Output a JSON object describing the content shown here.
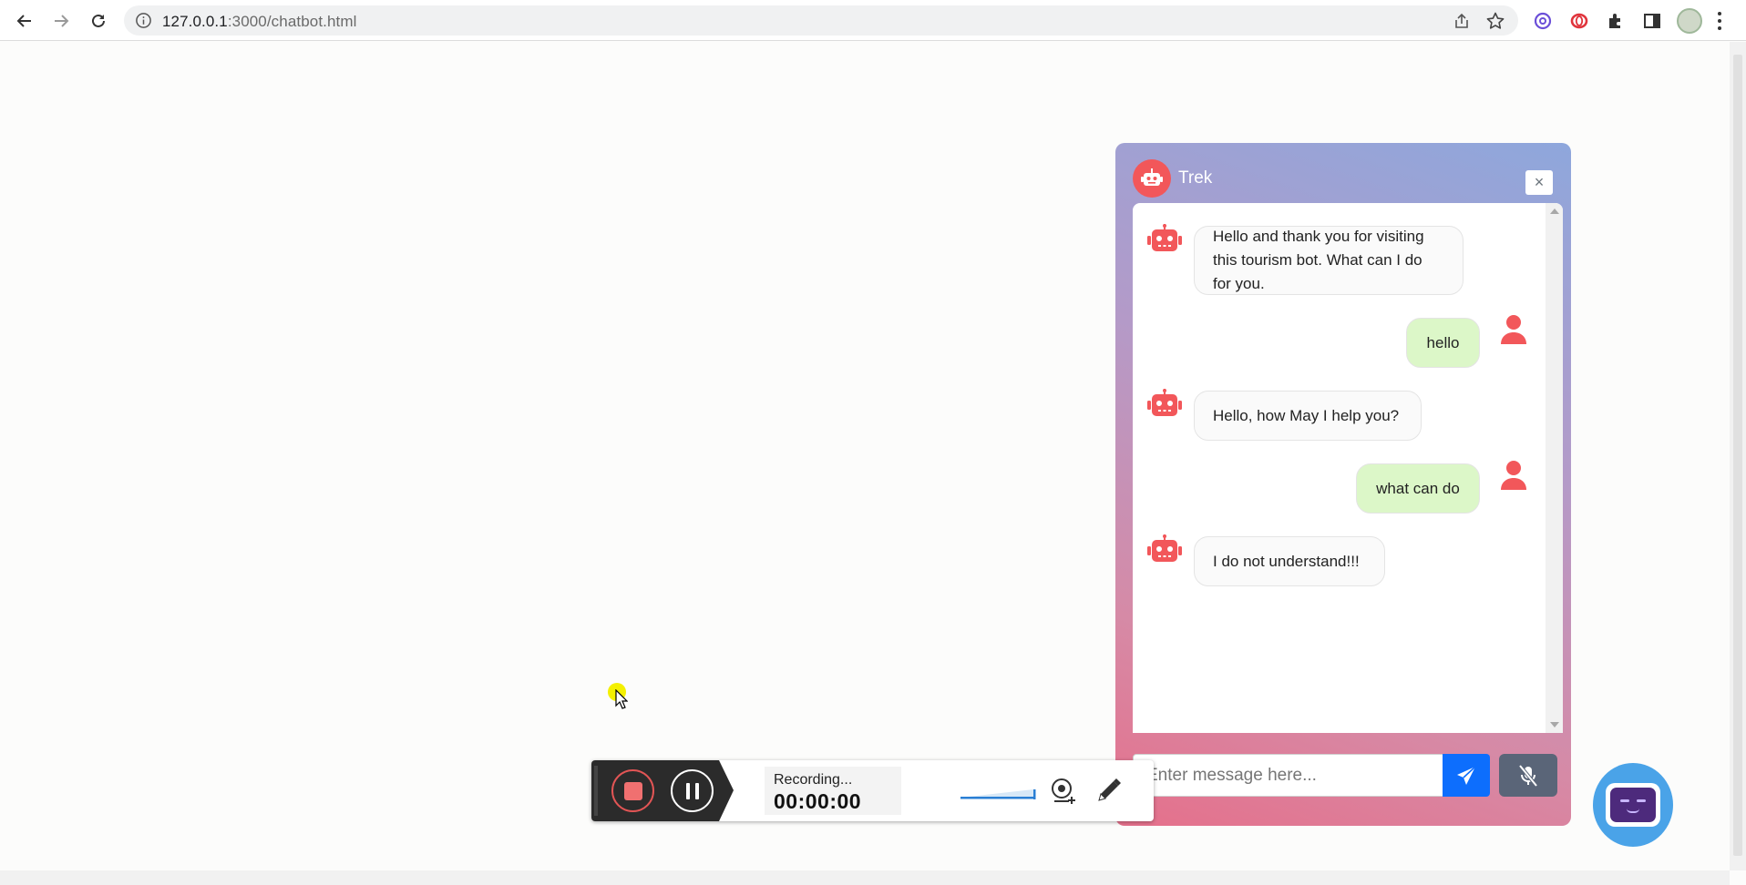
{
  "browser": {
    "url_host": "127.0.0.1",
    "url_rest": ":3000/chatbot.html"
  },
  "chatbot": {
    "title": "Trek",
    "close_label": "×",
    "messages": [
      {
        "sender": "bot",
        "text": "Hello and thank you for visiting this tourism bot. What can I do for you."
      },
      {
        "sender": "user",
        "text": "hello"
      },
      {
        "sender": "bot",
        "text": "Hello, how May I help you?"
      },
      {
        "sender": "user",
        "text": "what can do"
      },
      {
        "sender": "bot",
        "text": "I do not understand!!!"
      }
    ],
    "input_placeholder": "Enter message here...",
    "colors": {
      "accent": "#f2575a",
      "user_bubble": "#dcf7c8",
      "send_button": "#0d6efd",
      "mic_button": "#5a6578"
    }
  },
  "recorder": {
    "status": "Recording...",
    "time": "00:00:00"
  }
}
